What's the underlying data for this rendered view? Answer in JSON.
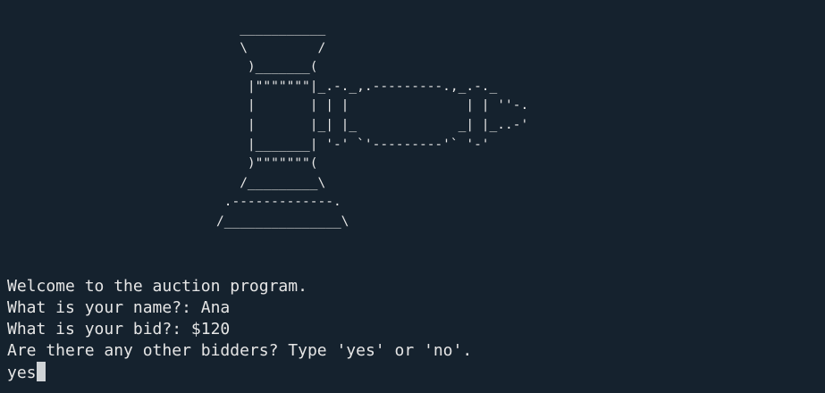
{
  "terminal": {
    "ascii_art": "   ___________\n   \\         /\n    )_______(\n    |\"\"\"\"\"\"\"|_.-._,.---------.,_.-._\n    |       | | |               | | ''-.\n    |       |_| |_             _| |_..-'\n    |_______| '-' `'---------'` '-'\n    )\"\"\"\"\"\"\"(\n   /_________\\\n .-------------.\n/_______________\\",
    "lines": [
      "Welcome to the auction program.",
      "What is your name?: Ana",
      "What is your bid?: $120",
      "Are there any other bidders? Type 'yes' or 'no'."
    ],
    "input_value": "yes"
  }
}
